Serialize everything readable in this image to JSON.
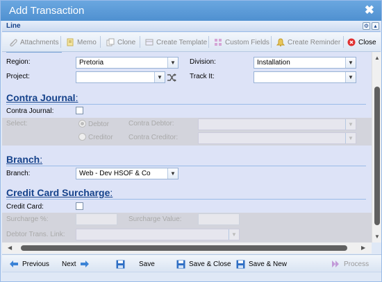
{
  "window": {
    "title": "Add Transaction",
    "close_glyph": "✖"
  },
  "panel": {
    "header": "Line"
  },
  "toolbar": {
    "attachments": "Attachments",
    "memo": "Memo",
    "clone": "Clone",
    "create_template": "Create Template",
    "custom_fields": "Custom Fields",
    "create_reminder": "Create Reminder",
    "close": "Close"
  },
  "form": {
    "region_label": "Region:",
    "region_value": "Pretoria",
    "division_label": "Division:",
    "division_value": "Installation",
    "project_label": "Project:",
    "project_value": "",
    "trackit_label": "Track It:",
    "trackit_value": ""
  },
  "contra": {
    "heading": "Contra Journal",
    "colon": ":",
    "checkbox_label": "Contra Journal:",
    "select_label": "Select:",
    "debtor_label": "Debtor",
    "creditor_label": "Creditor",
    "contra_debtor_label": "Contra Debtor:",
    "contra_creditor_label": "Contra Creditor:"
  },
  "branch": {
    "heading": "Branch",
    "colon": ":",
    "label": "Branch:",
    "value": "Web - Dev HSOF & Co"
  },
  "credit_card": {
    "heading": "Credit Card Surcharge",
    "colon": ":",
    "checkbox_label": "Credit Card:",
    "surcharge_pct_label": "Surcharge %:",
    "surcharge_value_label": "Surcharge Value:",
    "debtor_trans_link_label": "Debtor Trans. Link:"
  },
  "bottom": {
    "previous": "Previous",
    "next": "Next",
    "save": "Save",
    "save_close": "Save & Close",
    "save_new": "Save & New",
    "process": "Process"
  },
  "colors": {
    "title_bar": "#5b9bd5",
    "heading": "#15428b",
    "content_bg": "#dde3f7",
    "close_icon": "#e03030"
  }
}
